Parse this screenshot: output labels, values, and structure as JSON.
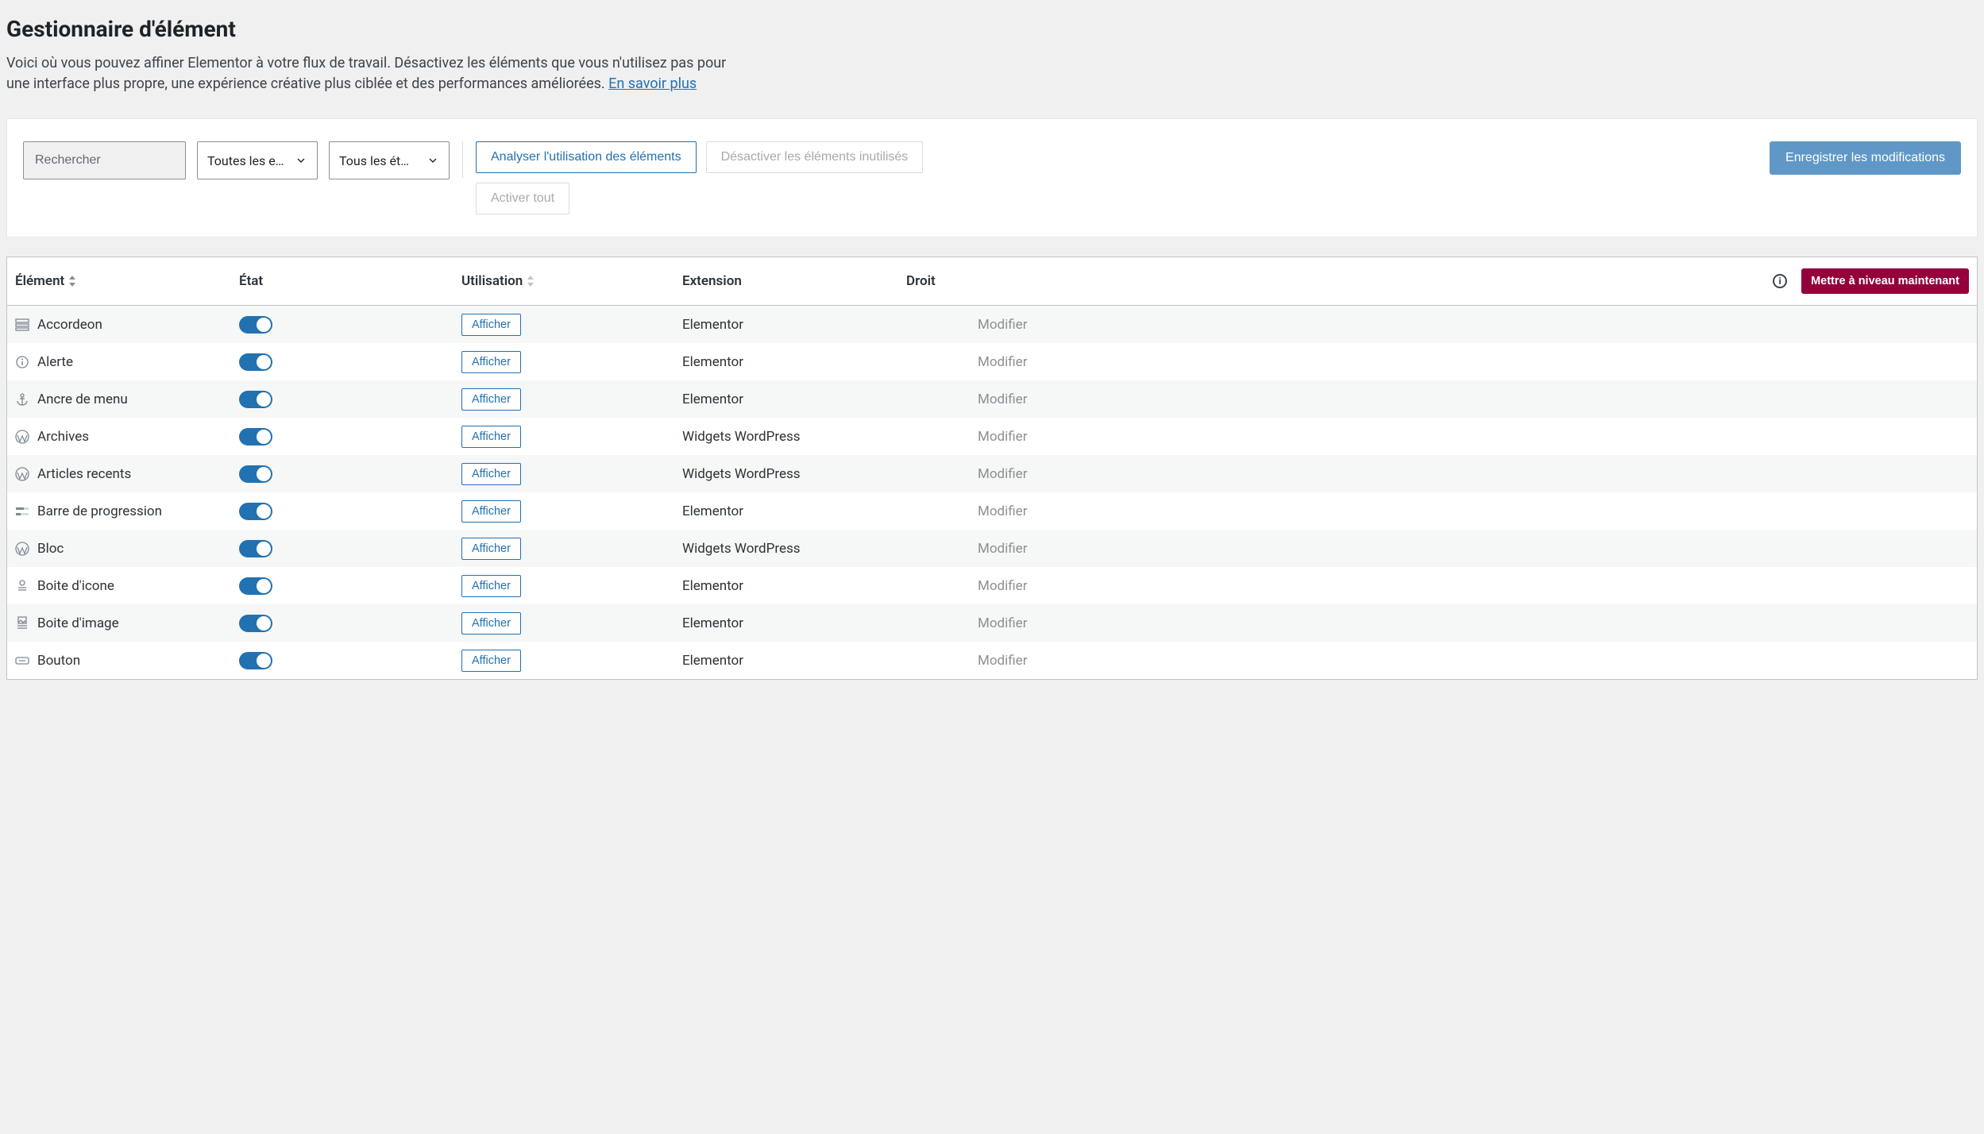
{
  "header": {
    "title": "Gestionnaire d'élément",
    "description_a": "Voici où vous pouvez affiner Elementor à votre flux de travail. Désactivez les éléments que vous n'utilisez pas pour une interface plus propre, une expérience créative plus ciblée et des performances améliorées. ",
    "learn_more": "En savoir plus"
  },
  "toolbar": {
    "search_placeholder": "Rechercher",
    "filter_ext": "Toutes les e…",
    "filter_status": "Tous les ét…",
    "scan_label": "Analyser l'utilisation des éléments",
    "disable_unused_label": "Désactiver les éléments inutilisés",
    "enable_all_label": "Activer tout",
    "save_label": "Enregistrer les modifications"
  },
  "table": {
    "headers": {
      "element": "Élément",
      "state": "État",
      "usage": "Utilisation",
      "extension": "Extension",
      "right": "Droit"
    },
    "upgrade_label": "Mettre à niveau maintenant",
    "show_label": "Afficher",
    "edit_label": "Modifier",
    "rows": [
      {
        "icon": "accordion",
        "name": "Accordeon",
        "ext": "Elementor"
      },
      {
        "icon": "info",
        "name": "Alerte",
        "ext": "Elementor"
      },
      {
        "icon": "anchor",
        "name": "Ancre de menu",
        "ext": "Elementor"
      },
      {
        "icon": "wp",
        "name": "Archives",
        "ext": "Widgets WordPress"
      },
      {
        "icon": "wp",
        "name": "Articles recents",
        "ext": "Widgets WordPress"
      },
      {
        "icon": "progress",
        "name": "Barre de progression",
        "ext": "Elementor"
      },
      {
        "icon": "wp",
        "name": "Bloc",
        "ext": "Widgets WordPress"
      },
      {
        "icon": "iconbox",
        "name": "Boite d'icone",
        "ext": "Elementor"
      },
      {
        "icon": "imagebox",
        "name": "Boite d'image",
        "ext": "Elementor"
      },
      {
        "icon": "button",
        "name": "Bouton",
        "ext": "Elementor"
      }
    ]
  }
}
